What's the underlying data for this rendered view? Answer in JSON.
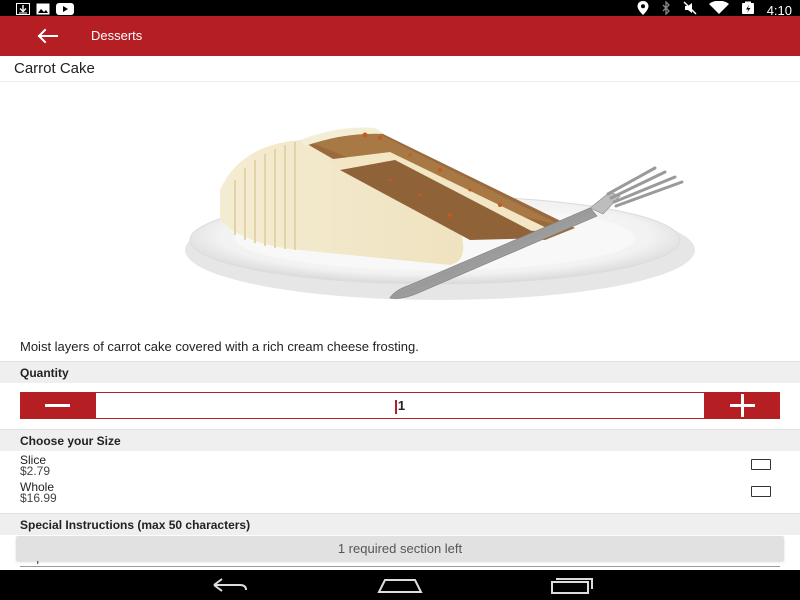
{
  "status_bar": {
    "time": "4:10",
    "left_icons": [
      "download-icon",
      "image-icon",
      "youtube-icon"
    ],
    "right_icons": [
      "location-icon",
      "bluetooth-icon",
      "mute-icon",
      "wifi-icon",
      "battery-charging-icon"
    ]
  },
  "app_bar": {
    "title": "Desserts",
    "back_icon": "arrow-back-icon",
    "color": "#b51f24"
  },
  "product": {
    "title": "Carrot Cake",
    "description": "Moist layers of carrot cake covered with a rich cream cheese frosting.",
    "image": "carrot-cake-slice-on-plate"
  },
  "quantity": {
    "header": "Quantity",
    "value": "1",
    "minus_icon": "minus-icon",
    "plus_icon": "plus-icon"
  },
  "size": {
    "header": "Choose your Size",
    "options": [
      {
        "name": "Slice",
        "price": "$2.79",
        "checked": false
      },
      {
        "name": "Whole",
        "price": "$16.99",
        "checked": false
      }
    ]
  },
  "instructions": {
    "header": "Special Instructions (max 50 characters)",
    "placeholder": "Special Instructions"
  },
  "banner": {
    "text": "1 required section left"
  },
  "nav_bar": {
    "icons": [
      "back-nav-icon",
      "home-nav-icon",
      "recents-nav-icon"
    ]
  }
}
